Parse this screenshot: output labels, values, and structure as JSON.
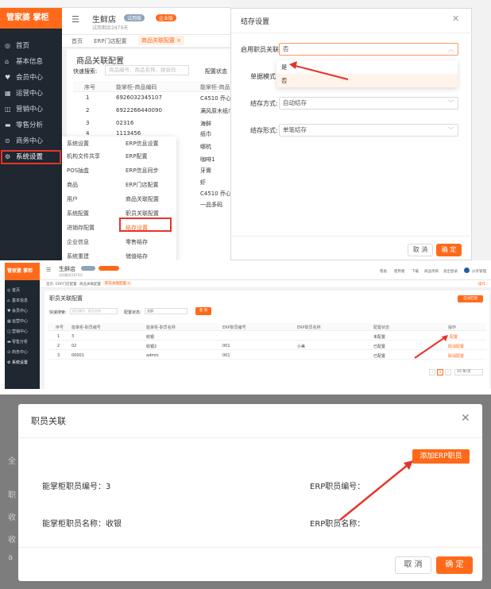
{
  "panel1": {
    "brand": "管家婆 掌柜",
    "store": {
      "name": "生鲜店",
      "trial": "试用剩余2879天",
      "badges": [
        "试用版",
        "企业版"
      ]
    },
    "sidebar": [
      "首页",
      "基本信息",
      "会员中心",
      "运营中心",
      "营销中心",
      "零售分析",
      "商务中心",
      "系统设置"
    ],
    "tabs": [
      "首页",
      "ERP门店配置",
      "商品关联配置"
    ],
    "page_title": "商品关联配置",
    "search_label": "快速搜索:",
    "search_placeholder": "商品编号、商品名称、拼音码",
    "status_label": "配置状态",
    "table_headers": [
      "序号",
      "能掌柜-商品编码",
      "能掌柜-商品"
    ],
    "rows": [
      {
        "no": "1",
        "code": "6926032345107",
        "name": "C4510 乔心力"
      },
      {
        "no": "2",
        "code": "6922266440090",
        "name": "满风原木纸巾"
      },
      {
        "no": "3",
        "code": "02316",
        "name": "海鲜"
      },
      {
        "no": "4",
        "code": "1113456",
        "name": "纸巾"
      }
    ],
    "extra_names": [
      "哪杭",
      "咖啡1",
      "牙膏",
      "虾",
      "C4510 乔心力",
      "一品多码"
    ],
    "menu": {
      "left": [
        "系统设置",
        "机构文件共享",
        "POS抽盒",
        "商品",
        "用户",
        "系统配置",
        "进销存配置",
        "企业信息",
        "系统重建"
      ],
      "right": [
        "ERP信息设置",
        "ERP配置",
        "ERP信息同步",
        "ERP门店配置",
        "商品关联配置",
        "职员关联配置",
        "结存设置",
        "零售结存",
        "储值结存"
      ]
    },
    "dialog": {
      "title": "结存设置",
      "fields": [
        {
          "label": "启用职员关联:",
          "value": "否"
        },
        {
          "label": "单据模式:",
          "value": ""
        },
        {
          "label": "结存方式:",
          "value": "自动结存"
        },
        {
          "label": "结存形式:",
          "value": "单笔结存"
        }
      ],
      "options": [
        "是",
        "否"
      ],
      "cancel": "取 消",
      "ok": "确 定"
    }
  },
  "panel2": {
    "brand": "管家婆 掌柜",
    "store": {
      "name": "生鲜店",
      "trial": "试用剩余2879天"
    },
    "header_links": [
      "帮助",
      "使用者",
      "下载",
      "商品项目",
      "退出登录",
      "分享管理"
    ],
    "sidebar": [
      "首页",
      "基本信息",
      "会员中心",
      "运营中心",
      "营销中心",
      "零售分析",
      "商务中心",
      "系统设置"
    ],
    "tabs": [
      "首页",
      "ERP门店配置",
      "商品关联配置",
      "职员关联配置"
    ],
    "page_title": "职员关联配置",
    "top_right_button": "自动匹配",
    "search_label": "快速搜索:",
    "search_placeholder": "职员编号、职员名称",
    "status_label": "配置状态:",
    "status_value": "全部",
    "query_button": "查 询",
    "headers": [
      "序号",
      "能掌柜-职员编号",
      "能掌柜-职员名称",
      "ERP职员编号",
      "ERP职员名称",
      "配置状态",
      "操作"
    ],
    "rows": [
      {
        "no": "1",
        "code": "3",
        "name": "收银",
        "erp_code": "",
        "erp_name": "",
        "status": "未配置",
        "op": "配置"
      },
      {
        "no": "2",
        "code": "02",
        "name": "收银2",
        "erp_code": "001",
        "erp_name": "小美",
        "status": "已配置",
        "op": "取消配置"
      },
      {
        "no": "3",
        "code": "00001",
        "name": "admin",
        "erp_code": "001",
        "erp_name": "",
        "status": "已配置",
        "op": "取消配置"
      }
    ],
    "pagination": {
      "page": "1",
      "size": "10 条/页"
    }
  },
  "panel3": {
    "title": "职员关联",
    "add_button": "添加ERP职员",
    "labels": {
      "code": "能掌柜职员编号：3",
      "name": "能掌柜职员名称：收银",
      "erp_code": "ERP职员编号：",
      "erp_name": "ERP职员名称："
    },
    "bg_fragments": [
      "全",
      "职",
      "收",
      "收",
      "a"
    ],
    "cancel": "取 消",
    "ok": "确 定"
  },
  "colors": {
    "accent": "#ff6a1a",
    "sidebar": "#1f2730",
    "highlight": "#e8332a"
  }
}
